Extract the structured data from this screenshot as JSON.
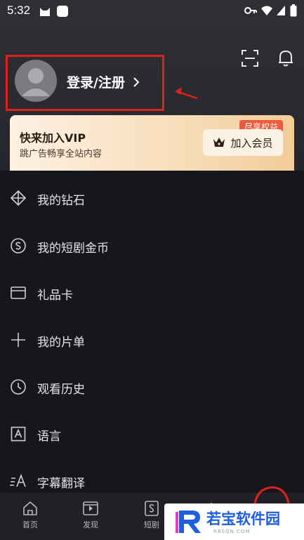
{
  "status_bar": {
    "time": "5:32",
    "icons": [
      "cat-icon",
      "square-icon",
      "key-icon",
      "wifi-icon",
      "signal-icon",
      "battery-icon"
    ]
  },
  "header": {
    "icons": [
      "scan-icon",
      "bell-icon"
    ]
  },
  "profile": {
    "login_label": "登录/注册"
  },
  "vip_banner": {
    "title": "快来加入VIP",
    "subtitle": "跳广告畅享全站内容",
    "badge": "尽享权益",
    "button_label": "加入会员"
  },
  "menu": {
    "items": [
      {
        "label": "我的钻石",
        "icon": "diamond-icon"
      },
      {
        "label": "我的短剧金币",
        "icon": "coin-icon"
      },
      {
        "label": "礼品卡",
        "icon": "card-icon"
      },
      {
        "label": "我的片单",
        "icon": "plus-icon"
      },
      {
        "label": "观看历史",
        "icon": "clock-icon"
      },
      {
        "label": "语言",
        "icon": "language-icon"
      },
      {
        "label": "字幕翻译",
        "icon": "subtitle-icon"
      }
    ]
  },
  "tabbar": {
    "tabs": [
      {
        "label": "首页",
        "icon": "home-icon"
      },
      {
        "label": "发现",
        "icon": "play-icon"
      },
      {
        "label": "短剧",
        "icon": "short-drama-icon"
      }
    ]
  },
  "watermark": {
    "text": "若宝软件园",
    "url": "RBSQN.COM"
  },
  "colors": {
    "annotation_red": "#e0201d",
    "background": "#16171c",
    "vip_gold": "#f1cc98",
    "badge_orange": "#f05a3a"
  }
}
